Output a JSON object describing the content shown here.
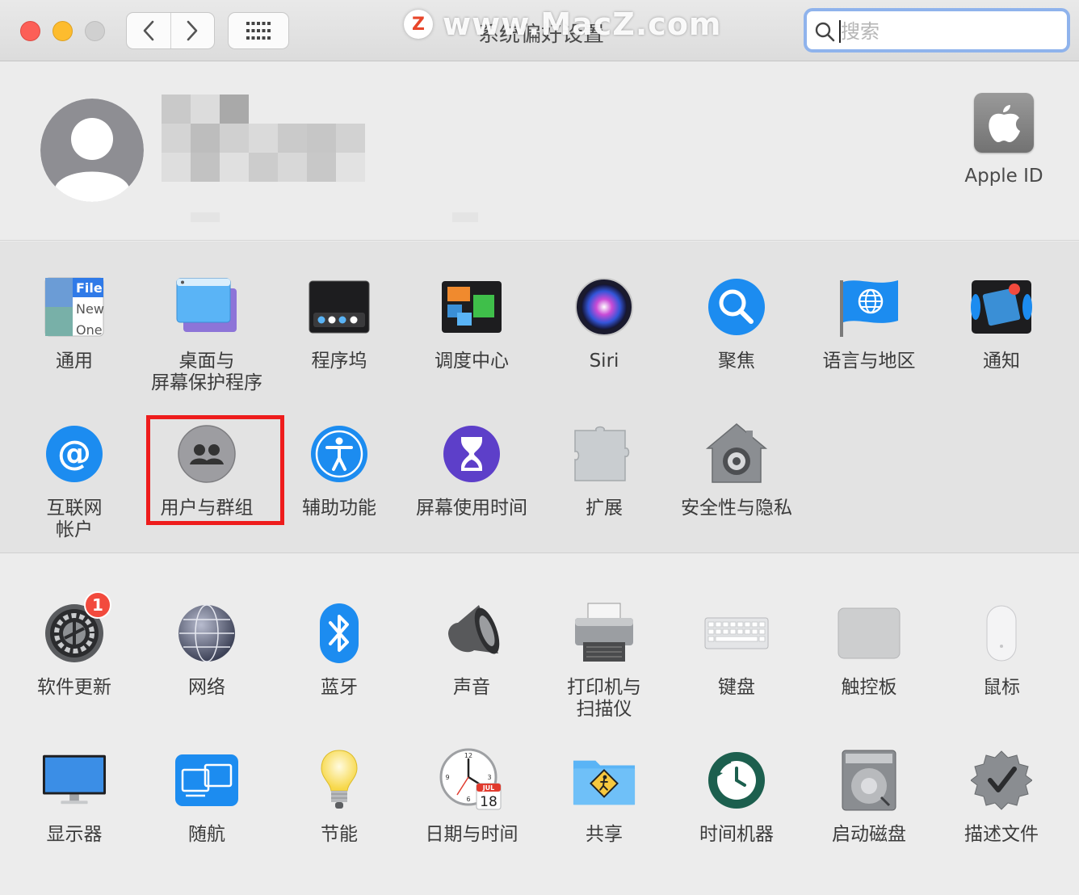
{
  "window": {
    "title": "系统偏好设置"
  },
  "watermark": {
    "text": "www.MacZ.com",
    "logo_letter": "Z"
  },
  "search": {
    "placeholder": "搜索",
    "value": ""
  },
  "account": {
    "apple_id_label": "Apple ID"
  },
  "icons": {
    "back": "chevron-left-icon",
    "forward": "chevron-right-icon",
    "show_all": "grid-icon",
    "search": "magnifying-glass-icon"
  },
  "colors": {
    "highlight": "#ee1c1c",
    "badge": "#f24a3d",
    "search_focus": "#8fb3ec"
  },
  "personal": {
    "row1": [
      {
        "id": "general",
        "label": "通用"
      },
      {
        "id": "desktop",
        "label": "桌面与\n屏幕保护程序"
      },
      {
        "id": "dock",
        "label": "程序坞"
      },
      {
        "id": "mission-control",
        "label": "调度中心"
      },
      {
        "id": "siri",
        "label": "Siri"
      },
      {
        "id": "spotlight",
        "label": "聚焦"
      },
      {
        "id": "language",
        "label": "语言与地区"
      },
      {
        "id": "notifications",
        "label": "通知"
      }
    ],
    "row2": [
      {
        "id": "internet-accounts",
        "label": "互联网\n帐户"
      },
      {
        "id": "users-groups",
        "label": "用户与群组",
        "highlighted": true
      },
      {
        "id": "accessibility",
        "label": "辅助功能"
      },
      {
        "id": "screen-time",
        "label": "屏幕使用时间"
      },
      {
        "id": "extensions",
        "label": "扩展"
      },
      {
        "id": "security",
        "label": "安全性与隐私"
      }
    ]
  },
  "hardware": {
    "row1": [
      {
        "id": "software-update",
        "label": "软件更新",
        "badge": "1"
      },
      {
        "id": "network",
        "label": "网络"
      },
      {
        "id": "bluetooth",
        "label": "蓝牙"
      },
      {
        "id": "sound",
        "label": "声音"
      },
      {
        "id": "printers",
        "label": "打印机与\n扫描仪"
      },
      {
        "id": "keyboard",
        "label": "键盘"
      },
      {
        "id": "trackpad",
        "label": "触控板"
      },
      {
        "id": "mouse",
        "label": "鼠标"
      }
    ],
    "row2": [
      {
        "id": "displays",
        "label": "显示器"
      },
      {
        "id": "sidecar",
        "label": "随航"
      },
      {
        "id": "energy",
        "label": "节能"
      },
      {
        "id": "date-time",
        "label": "日期与时间"
      },
      {
        "id": "sharing",
        "label": "共享"
      },
      {
        "id": "time-machine",
        "label": "时间机器"
      },
      {
        "id": "startup-disk",
        "label": "启动磁盘"
      },
      {
        "id": "profiles",
        "label": "描述文件"
      }
    ]
  },
  "icon_text": {
    "general_file": "File",
    "general_new": "New",
    "general_one": "One",
    "calendar_month": "JUL",
    "calendar_day": "18"
  }
}
